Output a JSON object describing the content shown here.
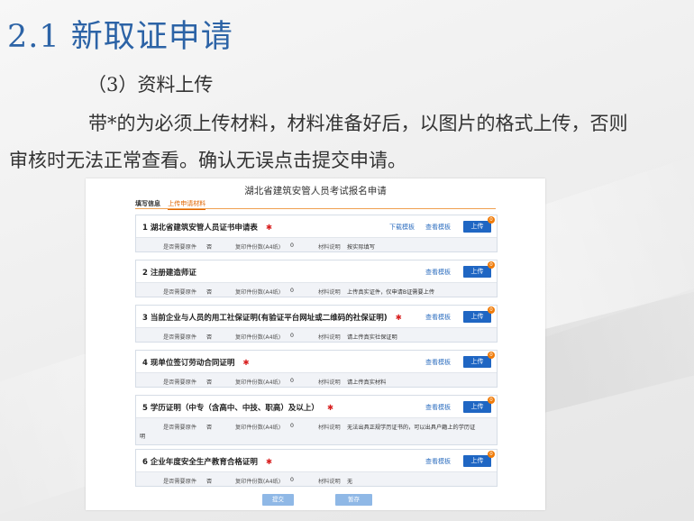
{
  "slide": {
    "title": "2.1 新取证申请",
    "subtitle": "（3）资料上传",
    "paragraph": "带*的为必须上传材料，材料准备好后，以图片的格式上传，否则审核时无法正常查看。确认无误点击提交申请。"
  },
  "form": {
    "title": "湖北省建筑安管人员考试报名申请",
    "tabs": [
      "填写信息",
      "上传申请材料"
    ],
    "labels": {
      "original": "是否需要原件",
      "copies": "复印件份数(A4纸)",
      "desc": "材料说明",
      "download": "下载模板",
      "view": "查看模板",
      "upload": "上传"
    },
    "items": [
      {
        "index": "1",
        "name": "湖北省建筑安管人员证书申请表",
        "required": "✱",
        "original": "否",
        "copies": "0",
        "desc": "按实际填写",
        "badge": "0"
      },
      {
        "index": "2",
        "name": "注册建造师证",
        "required": "",
        "original": "否",
        "copies": "0",
        "desc": "上传真实证件，仅申请B证需要上传",
        "badge": "0"
      },
      {
        "index": "3",
        "name": "当前企业与人员的用工社保证明(有验证平台网址或二维码的社保证明)",
        "required": "✱",
        "original": "否",
        "copies": "0",
        "desc": "请上传真实社保证明",
        "badge": "0"
      },
      {
        "index": "4",
        "name": "现单位签订劳动合同证明",
        "required": "✱",
        "original": "否",
        "copies": "0",
        "desc": "请上传真实材料",
        "badge": "0"
      },
      {
        "index": "5",
        "name": "学历证明（中专（含高中、中技、职高）及以上）",
        "required": "✱",
        "original": "否",
        "copies": "0",
        "desc": "无法出具正规学历证书的，可以出具户籍上的学历证",
        "desc_wrap": "明",
        "badge": "0"
      },
      {
        "index": "6",
        "name": "企业年度安全生产教育合格证明",
        "required": "✱",
        "original": "否",
        "copies": "0",
        "desc": "无",
        "badge": "0"
      }
    ],
    "submit_label": "提交",
    "save_label": "暂存"
  }
}
